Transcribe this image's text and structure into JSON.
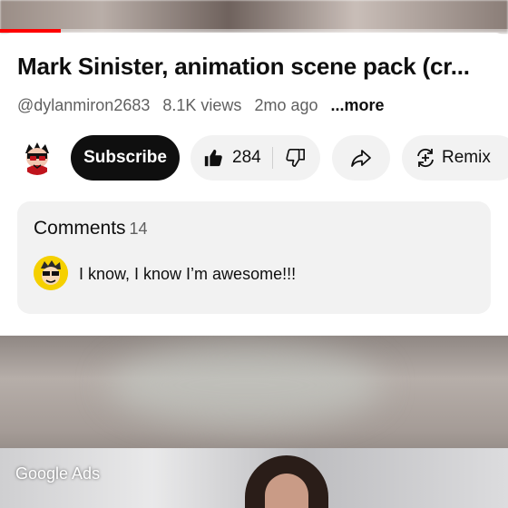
{
  "video": {
    "progress_fraction": 0.12,
    "accent_color": "#ff0000"
  },
  "title": "Mark Sinister, animation scene pack (cr...",
  "meta": {
    "channel": "@dylanmiron2683",
    "views": "8.1K views",
    "age": "2mo ago",
    "more": "...more"
  },
  "actions": {
    "channel_avatar_icon": "channel-avatar",
    "subscribe_label": "Subscribe",
    "like_count": "284",
    "like_icon": "thumbs-up-icon",
    "dislike_icon": "thumbs-down-icon",
    "share_icon": "share-icon",
    "remix_label": "Remix",
    "remix_icon": "remix-icon"
  },
  "comments": {
    "heading": "Comments",
    "count": "14",
    "top_comment": "I know, I know I’m awesome!!!"
  },
  "ad": {
    "label": "Google Ads"
  }
}
